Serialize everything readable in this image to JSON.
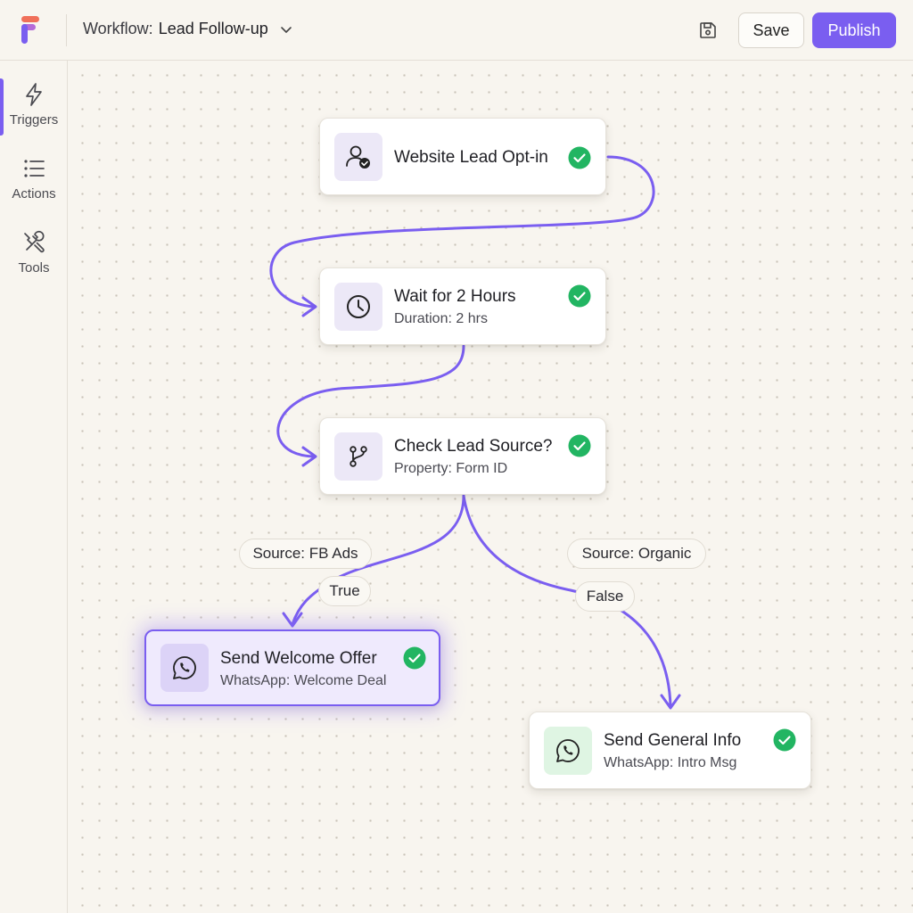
{
  "header": {
    "workflow_prefix": "Workflow:",
    "workflow_name": "Lead Follow-up",
    "save_label": "Save",
    "publish_label": "Publish"
  },
  "sidebar": {
    "items": [
      {
        "label": "Triggers",
        "icon": "lightning-icon",
        "active": true
      },
      {
        "label": "Actions",
        "icon": "list-icon",
        "active": false
      },
      {
        "label": "Tools",
        "icon": "tools-icon",
        "active": false
      }
    ]
  },
  "nodes": {
    "trigger": {
      "title": "Website Lead Opt-in",
      "icon": "user-check-icon",
      "status": "complete"
    },
    "wait": {
      "title": "Wait for 2 Hours",
      "subtitle": "Duration: 2 hrs",
      "icon": "clock-icon",
      "status": "complete"
    },
    "check": {
      "title": "Check Lead Source?",
      "subtitle": "Property: Form ID",
      "icon": "branch-icon",
      "status": "complete"
    },
    "welcome": {
      "title": "Send Welcome Offer",
      "subtitle": "WhatsApp: Welcome Deal",
      "icon": "whatsapp-icon",
      "status": "complete"
    },
    "general": {
      "title": "Send General Info",
      "subtitle": "WhatsApp: Intro Msg",
      "icon": "whatsapp-icon",
      "status": "complete"
    }
  },
  "branches": {
    "true_condition": "Source: FB Ads",
    "true_label": "True",
    "false_condition": "Source: Organic",
    "false_label": "False"
  },
  "colors": {
    "accent": "#7a5ef0",
    "success": "#22b562",
    "whatsapp_bg": "#dff5e3"
  }
}
